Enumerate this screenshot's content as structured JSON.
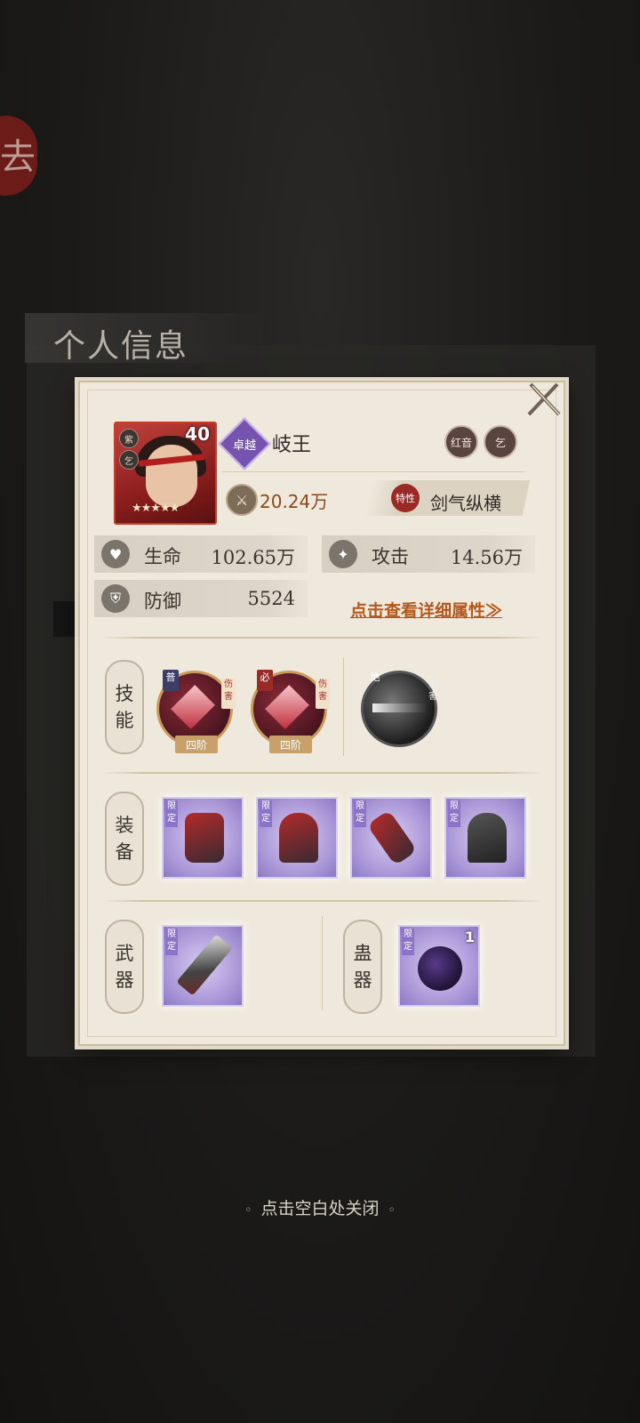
{
  "background": {
    "banner_title": "个人信息",
    "seal_char": "去"
  },
  "hero": {
    "level": "40",
    "stars": "★★★★★",
    "portrait_badges": [
      "紫",
      "乞"
    ],
    "rank_badge": "卓越",
    "name": "岐王",
    "tags": [
      "红音",
      "乞"
    ],
    "power": "20.24万",
    "trait_icon": "特性",
    "trait_name": "剑气纵横"
  },
  "stats": {
    "hp_label": "生命",
    "hp_value": "102.65万",
    "atk_label": "攻击",
    "atk_value": "14.56万",
    "def_label": "防御",
    "def_value": "5524",
    "detail_link": "点击查看详细属性≫"
  },
  "sections": {
    "skills": {
      "label_chars": [
        "技",
        "能"
      ]
    },
    "equipment": {
      "label_chars": [
        "装",
        "备"
      ]
    },
    "weapon": {
      "label_chars": [
        "武",
        "器"
      ]
    },
    "gu": {
      "label_chars": [
        "蛊",
        "器"
      ]
    }
  },
  "skills": [
    {
      "type": "普",
      "side": "伤害",
      "tier": "四阶"
    },
    {
      "type": "必",
      "side": "伤害",
      "tier": "四阶"
    },
    {
      "type": "绝",
      "side": "伤害",
      "tier": ""
    }
  ],
  "items": {
    "limit_tag": "限定",
    "gu_count": "1"
  },
  "close_hint": "点击空白处关闭",
  "icons": {
    "close": "close-icon",
    "hp": "heart-icon",
    "atk": "sword-icon",
    "def": "shield-icon",
    "power": "crossed-swords-icon"
  },
  "colors": {
    "card_bg": "#efe9dd",
    "accent_link": "#b4581d",
    "rank_purple": "#7753b0",
    "trait_red": "#9a2a26"
  }
}
